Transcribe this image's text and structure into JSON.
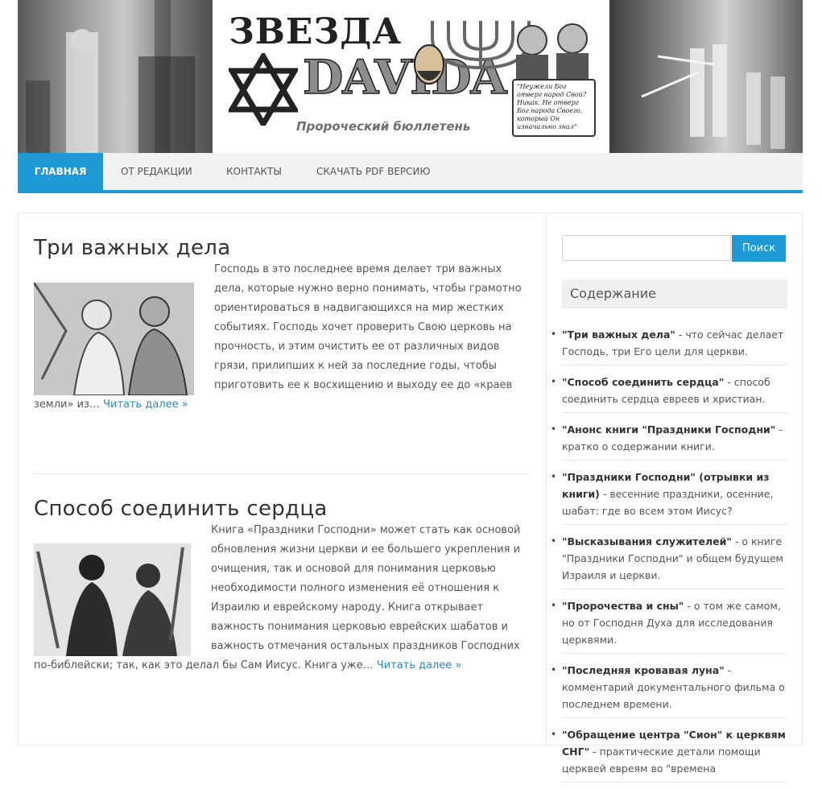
{
  "header": {
    "logo_title_1": "ЗВЕЗДА",
    "logo_title_2": "DAVIDA",
    "logo_subtitle": "Пророческий бюллетень",
    "logo_quote": "\"Неужели Бог отверг народ Свой? Никак. Не отверг Бог народа Своего, который Он изначально знал\""
  },
  "nav": {
    "items": [
      {
        "label": "Главная"
      },
      {
        "label": "От редакции"
      },
      {
        "label": "Контакты"
      },
      {
        "label": "Скачать PDF версию"
      }
    ]
  },
  "posts": [
    {
      "title": "Три важных дела",
      "excerpt": "Господь в это последнее время делает три важных дела, которые нужно верно понимать, чтобы грамотно ориентироваться в надвигающихся на мир жестких событиях. Господь хочет проверить Свою церковь на прочность, и этим очистить ее от различных видов грязи, прилипших к ней за последние годы, чтобы приготовить ее к восхищению и выходу ее до «краев земли» из…",
      "read_more": "Читать далее »"
    },
    {
      "title": "Способ соединить сердца",
      "excerpt": "Книга «Праздники Господни» может стать как основой обновления жизни церкви и ее большего укрепления и очищения, так и основой для понимания церковью необходимости полного изменения её отношения к Израилю и еврейскому народу. Книга открывает важность понимания церковью еврейских шабатов и важность отмечания остальных праздников Господних по-библейски; так, как это делал бы Сам Иисус. Книга уже…",
      "read_more": "Читать далее »"
    }
  ],
  "sidebar": {
    "search": {
      "placeholder": "",
      "button": "Поиск"
    },
    "toc_title": "Содержание",
    "toc_items": [
      {
        "link": "\"Три важных дела\"",
        "desc": " - что сейчас делает Господь, три Его цели для церкви."
      },
      {
        "link": "\"Способ соединить сердца\"",
        "desc": " - способ соединить сердца евреев и христиан."
      },
      {
        "link": "\"Анонс книги \"Праздники Господни\"",
        "desc": " - кратко о содержании книги."
      },
      {
        "link": "\"Праздники Господни\" (отрывки из книги)",
        "desc": " - весенние праздники, осенние, шабат: где во всем этом Иисус?"
      },
      {
        "link": "\"Высказывания служителей\"",
        "desc": " - о книге \"Праздники Господни\" и общем будущем Израиля и церкви."
      },
      {
        "link": "\"Пророчества и сны\"",
        "desc": " - о том же самом, но от Господня Духа для исследования церквями."
      },
      {
        "link": "\"Последняя кровавая луна\"",
        "desc": " - комментарий документального фильма о последнем времени."
      },
      {
        "link": "\"Обращение центра \"Сион\" к церквям СНГ\"",
        "desc": " - практические детали помощи церквей евреям во \"времена"
      }
    ]
  },
  "colors": {
    "accent": "#1e9ad6",
    "link": "#1e8cc8"
  }
}
